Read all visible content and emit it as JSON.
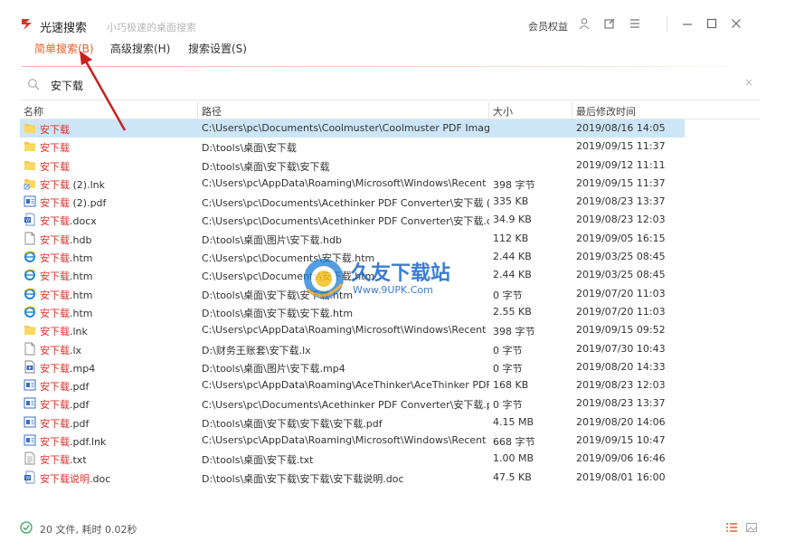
{
  "window": {
    "title": "光速搜索",
    "subtitle": "小巧极速的桌面搜索",
    "member_label": "会员权益",
    "controls": [
      "user-icon",
      "edit-icon",
      "menu-icon",
      "minimize-icon",
      "maximize-icon",
      "close-icon"
    ]
  },
  "tabs": [
    {
      "label": "简单搜索(B)",
      "active": true
    },
    {
      "label": "高级搜索(H)",
      "active": false
    },
    {
      "label": "搜索设置(S)",
      "active": false
    }
  ],
  "search": {
    "value": "安下载",
    "placeholder": ""
  },
  "table": {
    "columns": [
      "名称",
      "路径",
      "大小",
      "最后修改时间"
    ],
    "rows": [
      {
        "icon": "folder-icon",
        "hl": "安下载",
        "rest": "",
        "path": "C:\\Users\\pc\\Documents\\Coolmuster\\Coolmuster PDF Image",
        "size": "",
        "date": "2019/08/16 14:05",
        "selected": true
      },
      {
        "icon": "folder-icon",
        "hl": "安下载",
        "rest": "",
        "path": "D:\\tools\\桌面\\安下载",
        "size": "",
        "date": "2019/09/15 11:37"
      },
      {
        "icon": "folder-icon",
        "hl": "安下载",
        "rest": "",
        "path": "D:\\tools\\桌面\\安下载\\安下载",
        "size": "",
        "date": "2019/09/12 11:11"
      },
      {
        "icon": "shortcut-folder-icon",
        "hl": "安下载",
        "rest": " (2).lnk",
        "path": "C:\\Users\\pc\\AppData\\Roaming\\Microsoft\\Windows\\Recent",
        "size": "398 字节",
        "date": "2019/09/15 11:37"
      },
      {
        "icon": "pdf-file-icon",
        "hl": "安下载",
        "rest": " (2).pdf",
        "path": "C:\\Users\\pc\\Documents\\Acethinker PDF Converter\\安下载 (2",
        "size": "335 KB",
        "date": "2019/08/23 13:37"
      },
      {
        "icon": "word-doc-icon",
        "hl": "安下载",
        "rest": ".docx",
        "path": "C:\\Users\\pc\\Documents\\Acethinker PDF Converter\\安下载.do",
        "size": "34.9 KB",
        "date": "2019/08/23 12:03"
      },
      {
        "icon": "blank-file-icon",
        "hl": "安下载",
        "rest": ".hdb",
        "path": "D:\\tools\\桌面\\图片\\安下载.hdb",
        "size": "112 KB",
        "date": "2019/09/05 16:15"
      },
      {
        "icon": "ie-html-icon",
        "hl": "安下载",
        "rest": ".htm",
        "path": "C:\\Users\\pc\\Documents\\安下载.htm",
        "size": "2.44 KB",
        "date": "2019/03/25 08:45"
      },
      {
        "icon": "ie-html-icon",
        "hl": "安下载",
        "rest": ".htm",
        "path": "C:\\Users\\pc\\Documents\\安下载.htm",
        "size": "2.44 KB",
        "date": "2019/03/25 08:45"
      },
      {
        "icon": "ie-html-icon",
        "hl": "安下载",
        "rest": ".htm",
        "path": "D:\\tools\\桌面\\安下载\\安下载.htm",
        "size": "0 字节",
        "date": "2019/07/20 11:03"
      },
      {
        "icon": "ie-html-icon",
        "hl": "安下载",
        "rest": ".htm",
        "path": "D:\\tools\\桌面\\安下载\\安下载.htm",
        "size": "2.55 KB",
        "date": "2019/07/20 11:03"
      },
      {
        "icon": "folder-icon",
        "hl": "安下载",
        "rest": ".lnk",
        "path": "C:\\Users\\pc\\AppData\\Roaming\\Microsoft\\Windows\\Recent",
        "size": "398 字节",
        "date": "2019/09/15 09:52"
      },
      {
        "icon": "blank-file-icon",
        "hl": "安下载",
        "rest": ".lx",
        "path": "D:\\财务王账套\\安下载.lx",
        "size": "0 字节",
        "date": "2019/07/30 10:43"
      },
      {
        "icon": "video-file-icon",
        "hl": "安下载",
        "rest": ".mp4",
        "path": "D:\\tools\\桌面\\图片\\安下载.mp4",
        "size": "0 字节",
        "date": "2019/08/20 14:33"
      },
      {
        "icon": "pdf-file-icon",
        "hl": "安下载",
        "rest": ".pdf",
        "path": "C:\\Users\\pc\\AppData\\Roaming\\AceThinker\\AceThinker PDF",
        "size": "168 KB",
        "date": "2019/08/23 12:03"
      },
      {
        "icon": "pdf-file-icon",
        "hl": "安下载",
        "rest": ".pdf",
        "path": "C:\\Users\\pc\\Documents\\Acethinker PDF Converter\\安下载.pc",
        "size": "0 字节",
        "date": "2019/08/23 13:37"
      },
      {
        "icon": "pdf-file-icon",
        "hl": "安下载",
        "rest": ".pdf",
        "path": "D:\\tools\\桌面\\安下载\\安下载\\安下载.pdf",
        "size": "4.15 MB",
        "date": "2019/08/20 14:06"
      },
      {
        "icon": "pdf-file-icon",
        "hl": "安下载",
        "rest": ".pdf.lnk",
        "path": "C:\\Users\\pc\\AppData\\Roaming\\Microsoft\\Windows\\Recent",
        "size": "668 字节",
        "date": "2019/09/15 10:47"
      },
      {
        "icon": "text-file-icon",
        "hl": "安下载",
        "rest": ".txt",
        "path": "D:\\tools\\桌面\\安下载.txt",
        "size": "1.00 MB",
        "date": "2019/09/06 16:46"
      },
      {
        "icon": "word-doc-icon",
        "hl": "安下载说明",
        "rest": ".doc",
        "path": "D:\\tools\\桌面\\安下载\\安下载\\安下载说明.doc",
        "size": "47.5 KB",
        "date": "2019/08/01 16:00"
      }
    ]
  },
  "watermark": {
    "title": "久友下载站",
    "url": "Www.9UPK.Com"
  },
  "status": {
    "text": "20 文件, 耗时 0.02秒"
  },
  "colors": {
    "accent": "#e8602c",
    "highlight_text": "#e0312b",
    "selected_row": "#cde6f7",
    "folder": "#f6c94a"
  }
}
